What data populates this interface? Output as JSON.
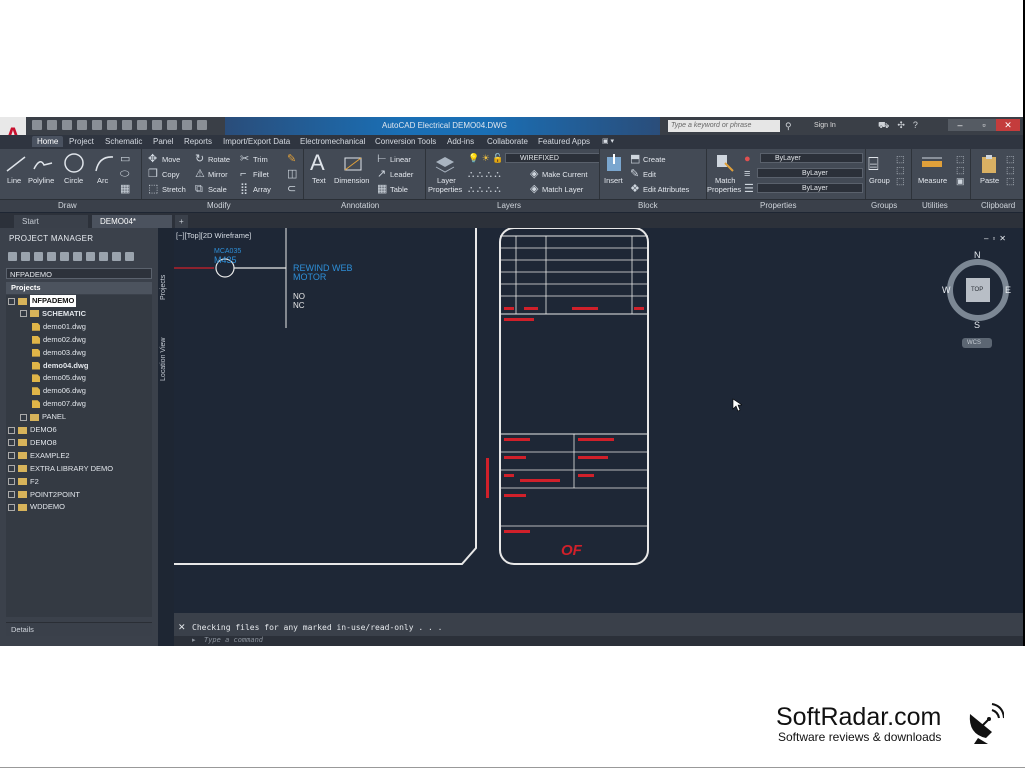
{
  "app": {
    "app_letter": "A",
    "title": "AutoCAD Electrical   DEMO04.DWG",
    "search_placeholder": "Type a keyword or phrase",
    "sign_in": "Sign In"
  },
  "ribbon_tabs": [
    "Home",
    "Project",
    "Schematic",
    "Panel",
    "Reports",
    "Import/Export Data",
    "Electromechanical",
    "Conversion Tools",
    "Add-ins",
    "Collaborate",
    "Featured Apps"
  ],
  "ribbon": {
    "draw": {
      "line": "Line",
      "polyline": "Polyline",
      "circle": "Circle",
      "arc": "Arc"
    },
    "modify": {
      "move": "Move",
      "copy": "Copy",
      "stretch": "Stretch",
      "rotate": "Rotate",
      "mirror": "Mirror",
      "scale": "Scale",
      "trim": "Trim",
      "fillet": "Fillet",
      "array": "Array"
    },
    "annotation": {
      "text": "Text",
      "dimension": "Dimension",
      "linear": "Linear",
      "leader": "Leader",
      "table": "Table"
    },
    "layers": {
      "layer_properties_1": "Layer",
      "layer_properties_2": "Properties",
      "layer_name": "WIREFIXED",
      "make_current": "Make Current",
      "match_layer": "Match Layer"
    },
    "block": {
      "insert": "Insert",
      "create": "Create",
      "edit": "Edit",
      "edit_attributes": "Edit Attributes"
    },
    "properties": {
      "match_1": "Match",
      "match_2": "Properties",
      "bylayer_1": "ByLayer",
      "bylayer_2": "ByLayer",
      "bylayer_3": "ByLayer"
    },
    "groups": {
      "group": "Group"
    },
    "utilities": {
      "measure": "Measure"
    },
    "clipboard": {
      "paste": "Paste"
    }
  },
  "panels": [
    "Draw",
    "Modify",
    "Annotation",
    "Layers",
    "Block",
    "Properties",
    "Groups",
    "Utilities",
    "Clipboard"
  ],
  "doc_tabs": {
    "start": "Start",
    "active": "DEMO04*"
  },
  "project_manager": {
    "title": "PROJECT MANAGER",
    "project_select": "NFPADEMO",
    "projects_header": "Projects",
    "tree": [
      {
        "label": "NFPADEMO",
        "level": 0,
        "kind": "folder",
        "state": "sel"
      },
      {
        "label": "SCHEMATIC",
        "level": 1,
        "kind": "folder",
        "state": "bold"
      },
      {
        "label": "demo01.dwg",
        "level": 2,
        "kind": "dwg",
        "state": ""
      },
      {
        "label": "demo02.dwg",
        "level": 2,
        "kind": "dwg",
        "state": ""
      },
      {
        "label": "demo03.dwg",
        "level": 2,
        "kind": "dwg",
        "state": ""
      },
      {
        "label": "demo04.dwg",
        "level": 2,
        "kind": "dwg",
        "state": "bold"
      },
      {
        "label": "demo05.dwg",
        "level": 2,
        "kind": "dwg",
        "state": ""
      },
      {
        "label": "demo06.dwg",
        "level": 2,
        "kind": "dwg",
        "state": ""
      },
      {
        "label": "demo07.dwg",
        "level": 2,
        "kind": "dwg",
        "state": ""
      },
      {
        "label": "PANEL",
        "level": 1,
        "kind": "folder",
        "state": ""
      },
      {
        "label": "DEMO6",
        "level": 0,
        "kind": "folder",
        "state": ""
      },
      {
        "label": "DEMO8",
        "level": 0,
        "kind": "folder",
        "state": ""
      },
      {
        "label": "EXAMPLE2",
        "level": 0,
        "kind": "folder",
        "state": ""
      },
      {
        "label": "EXTRA LIBRARY DEMO",
        "level": 0,
        "kind": "folder",
        "state": ""
      },
      {
        "label": "F2",
        "level": 0,
        "kind": "folder",
        "state": ""
      },
      {
        "label": "POINT2POINT",
        "level": 0,
        "kind": "folder",
        "state": ""
      },
      {
        "label": "WDDEMO",
        "level": 0,
        "kind": "folder",
        "state": ""
      }
    ],
    "details": "Details",
    "side_tab_projects": "Projects",
    "side_tab_location": "Location View"
  },
  "canvas": {
    "viewport_label": "[−][Top][2D Wireframe]",
    "component_tag_1": "MCA035",
    "component_tag_2": "M435",
    "desc_1": "REWIND WEB",
    "desc_2": "MOTOR",
    "contact_no": "NO",
    "contact_nc": "NC",
    "sheet_of": "OF",
    "viewcube": {
      "n": "N",
      "s": "S",
      "e": "E",
      "w": "W",
      "top": "TOP",
      "wcs": "WCS"
    }
  },
  "command": {
    "output": "Checking files for any marked in-use/read-only . . .",
    "placeholder": "Type a command"
  },
  "watermark": {
    "title": "SoftRadar.com",
    "subtitle": "Software reviews & downloads"
  },
  "colors": {
    "canvas_bg": "#1e2736",
    "cyan_text": "#2e8fd8",
    "red_text": "#d0202a",
    "ribbon_bg": "#434a55"
  }
}
